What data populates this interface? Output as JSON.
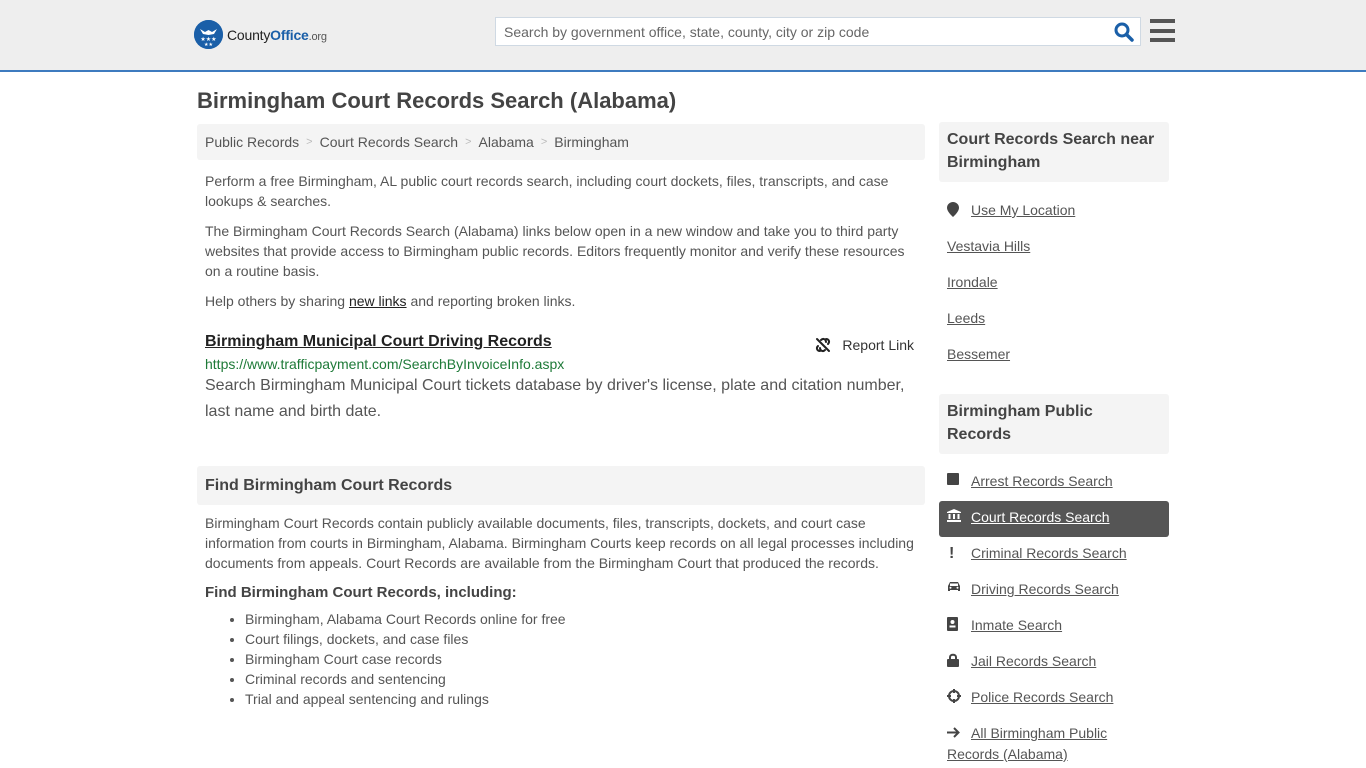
{
  "header": {
    "logo": {
      "prefix": "County",
      "bold": "Office",
      "suffix": ".org",
      "badge_symbol": "★★★"
    },
    "search": {
      "placeholder": "Search by government office, state, county, city or zip code",
      "value": ""
    },
    "brand_color": "#1a5fa8"
  },
  "page_title": "Birmingham Court Records Search (Alabama)",
  "breadcrumb": [
    "Public Records",
    "Court Records Search",
    "Alabama",
    "Birmingham"
  ],
  "breadcrumb_separator": ">",
  "intro": {
    "p1": "Perform a free Birmingham, AL public court records search, including court dockets, files, transcripts, and case lookups & searches.",
    "p2": "The Birmingham Court Records Search (Alabama) links below open in a new window and take you to third party websites that provide access to Birmingham public records. Editors frequently monitor and verify these resources on a routine basis.",
    "p3_before": "Help others by sharing ",
    "p3_link": "new links",
    "p3_after": " and reporting broken links."
  },
  "resource": {
    "title": "Birmingham Municipal Court Driving Records",
    "report_label": "Report Link",
    "url": "https://www.trafficpayment.com/SearchByInvoiceInfo.aspx",
    "description": "Search Birmingham Municipal Court tickets database by driver's license, plate and citation number, last name and birth date."
  },
  "find_section": {
    "heading": "Find Birmingham Court Records",
    "body": "Birmingham Court Records contain publicly available documents, files, transcripts, dockets, and court case information from courts in Birmingham, Alabama. Birmingham Courts keep records on all legal processes including documents from appeals. Court Records are available from the Birmingham Court that produced the records.",
    "subheading": "Find Birmingham Court Records, including:",
    "items": [
      "Birmingham, Alabama Court Records online for free",
      "Court filings, dockets, and case files",
      "Birmingham Court case records",
      "Criminal records and sentencing",
      "Trial and appeal sentencing and rulings"
    ]
  },
  "sidebar": {
    "nearby": {
      "heading": "Court Records Search near Birmingham",
      "use_location": "Use My Location",
      "cities": [
        "Vestavia Hills",
        "Irondale",
        "Leeds",
        "Bessemer"
      ]
    },
    "public_records": {
      "heading": "Birmingham Public Records",
      "items": [
        {
          "label": "Arrest Records Search",
          "icon": "square-icon",
          "glyph": "■",
          "active": false
        },
        {
          "label": "Court Records Search",
          "icon": "courthouse-icon",
          "glyph": "🏛",
          "active": true
        },
        {
          "label": "Criminal Records Search",
          "icon": "exclamation-icon",
          "glyph": "!",
          "active": false
        },
        {
          "label": "Driving Records Search",
          "icon": "car-icon",
          "glyph": "🚘",
          "active": false
        },
        {
          "label": "Inmate Search",
          "icon": "id-badge-icon",
          "glyph": "▣",
          "active": false
        },
        {
          "label": "Jail Records Search",
          "icon": "lock-icon",
          "glyph": "🔒",
          "active": false
        },
        {
          "label": "Police Records Search",
          "icon": "crosshair-icon",
          "glyph": "⊕",
          "active": false
        }
      ],
      "all_link": "All Birmingham Public Records (Alabama)",
      "all_glyph": "➔"
    }
  }
}
